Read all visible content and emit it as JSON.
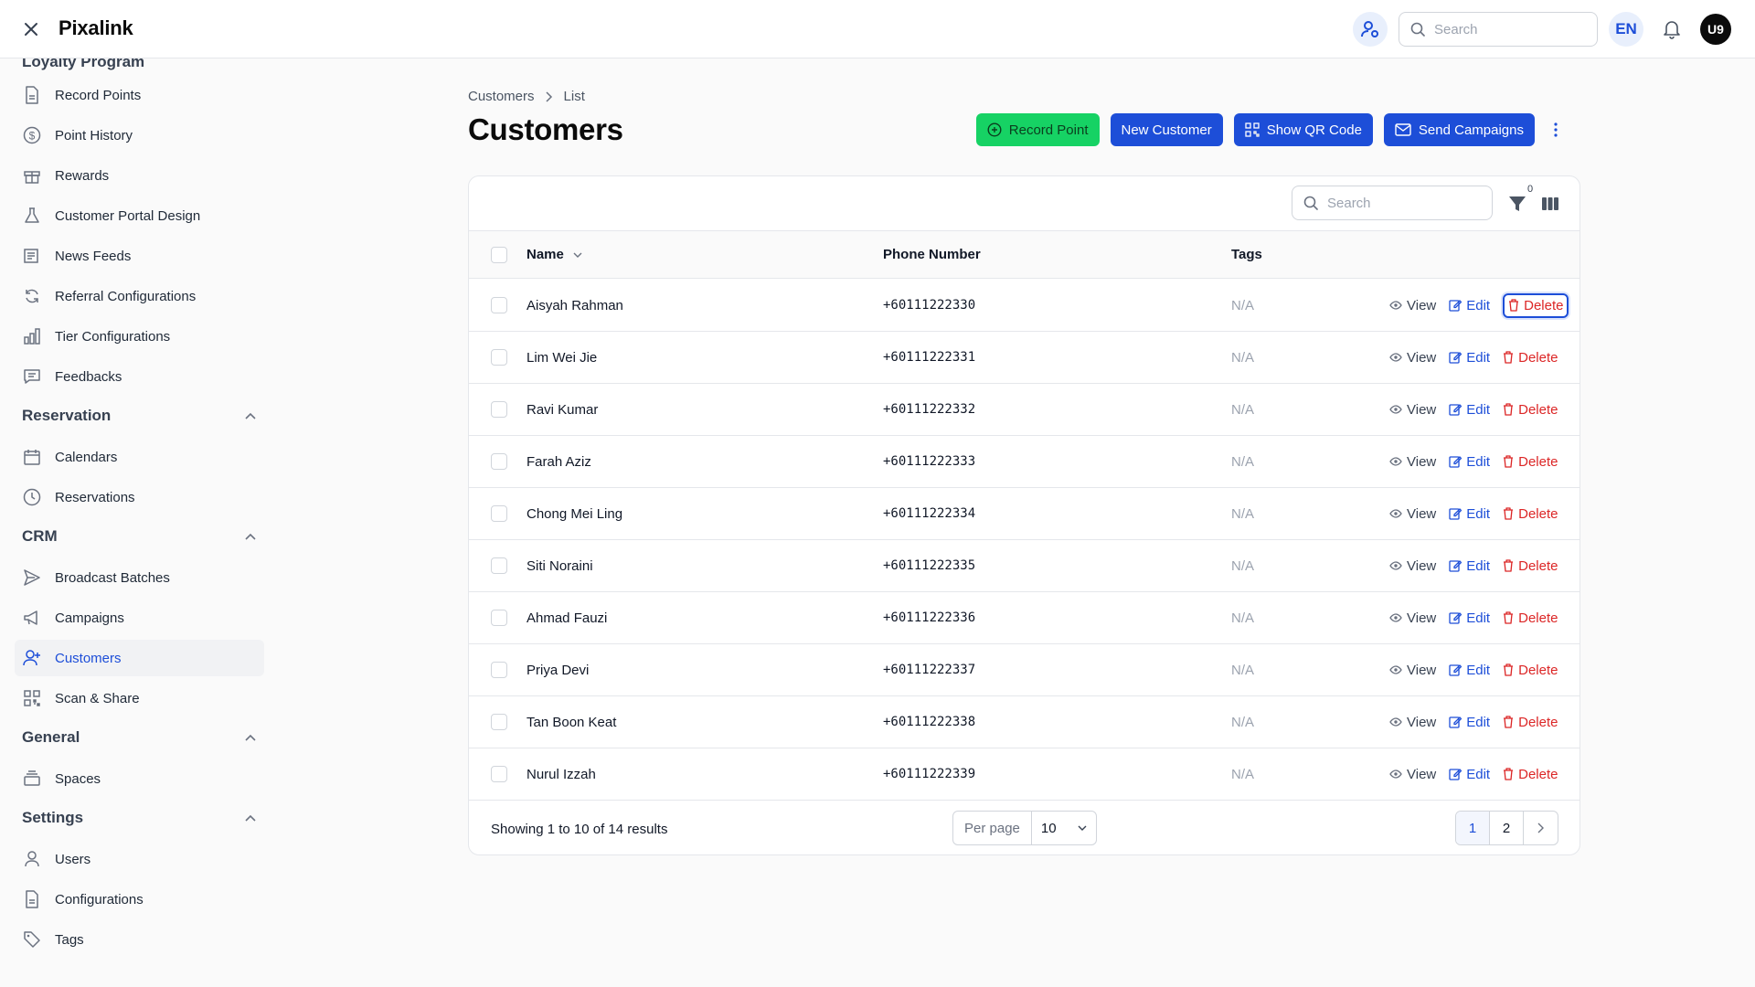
{
  "app": {
    "brand": "Pixalink"
  },
  "topbar": {
    "search_placeholder": "Search",
    "lang": "EN",
    "avatar": "U9"
  },
  "sidebar": {
    "clipped_heading": "Loyalty Program",
    "loyalty": [
      {
        "label": "Record Points",
        "icon": "file-icon"
      },
      {
        "label": "Point History",
        "icon": "dollar-circle-icon"
      },
      {
        "label": "Rewards",
        "icon": "gift-icon"
      },
      {
        "label": "Customer Portal Design",
        "icon": "flask-icon"
      },
      {
        "label": "News Feeds",
        "icon": "newspaper-icon"
      },
      {
        "label": "Referral Configurations",
        "icon": "refresh-icon"
      },
      {
        "label": "Tier Configurations",
        "icon": "bar-chart-icon"
      },
      {
        "label": "Feedbacks",
        "icon": "chat-icon"
      }
    ],
    "sections": {
      "reservation": "Reservation",
      "crm": "CRM",
      "general": "General",
      "settings": "Settings"
    },
    "reservation": [
      {
        "label": "Calendars",
        "icon": "calendar-icon"
      },
      {
        "label": "Reservations",
        "icon": "clock-icon"
      }
    ],
    "crm": [
      {
        "label": "Broadcast Batches",
        "icon": "send-icon"
      },
      {
        "label": "Campaigns",
        "icon": "megaphone-icon"
      },
      {
        "label": "Customers",
        "icon": "user-plus-icon"
      },
      {
        "label": "Scan & Share",
        "icon": "qr-icon"
      }
    ],
    "general": [
      {
        "label": "Spaces",
        "icon": "stack-icon"
      }
    ],
    "settings": [
      {
        "label": "Users",
        "icon": "user-icon"
      },
      {
        "label": "Configurations",
        "icon": "file-icon"
      },
      {
        "label": "Tags",
        "icon": "tag-icon"
      }
    ]
  },
  "breadcrumb": {
    "first": "Customers",
    "second": "List"
  },
  "page": {
    "title": "Customers"
  },
  "actions": {
    "record_point": "Record Point",
    "new_customer": "New Customer",
    "show_qr": "Show QR Code",
    "send_campaigns": "Send Campaigns"
  },
  "table": {
    "search_placeholder": "Search",
    "filter_count": "0",
    "columns": {
      "name": "Name",
      "phone": "Phone Number",
      "tags": "Tags"
    },
    "action_labels": {
      "view": "View",
      "edit": "Edit",
      "delete": "Delete"
    },
    "rows": [
      {
        "name": "Aisyah Rahman",
        "phone": "+60111222330",
        "tags": "N/A"
      },
      {
        "name": "Lim Wei Jie",
        "phone": "+60111222331",
        "tags": "N/A"
      },
      {
        "name": "Ravi Kumar",
        "phone": "+60111222332",
        "tags": "N/A"
      },
      {
        "name": "Farah Aziz",
        "phone": "+60111222333",
        "tags": "N/A"
      },
      {
        "name": "Chong Mei Ling",
        "phone": "+60111222334",
        "tags": "N/A"
      },
      {
        "name": "Siti Noraini",
        "phone": "+60111222335",
        "tags": "N/A"
      },
      {
        "name": "Ahmad Fauzi",
        "phone": "+60111222336",
        "tags": "N/A"
      },
      {
        "name": "Priya Devi",
        "phone": "+60111222337",
        "tags": "N/A"
      },
      {
        "name": "Tan Boon Keat",
        "phone": "+60111222338",
        "tags": "N/A"
      },
      {
        "name": "Nurul Izzah",
        "phone": "+60111222339",
        "tags": "N/A"
      }
    ],
    "footer": {
      "showing": "Showing 1 to 10 of 14 results",
      "per_page_label": "Per page",
      "per_page_value": "10",
      "pages": [
        "1",
        "2"
      ],
      "current_page": "1"
    }
  },
  "colors": {
    "accent": "#1d4ed8",
    "success": "#16d264",
    "danger": "#dc2626"
  }
}
